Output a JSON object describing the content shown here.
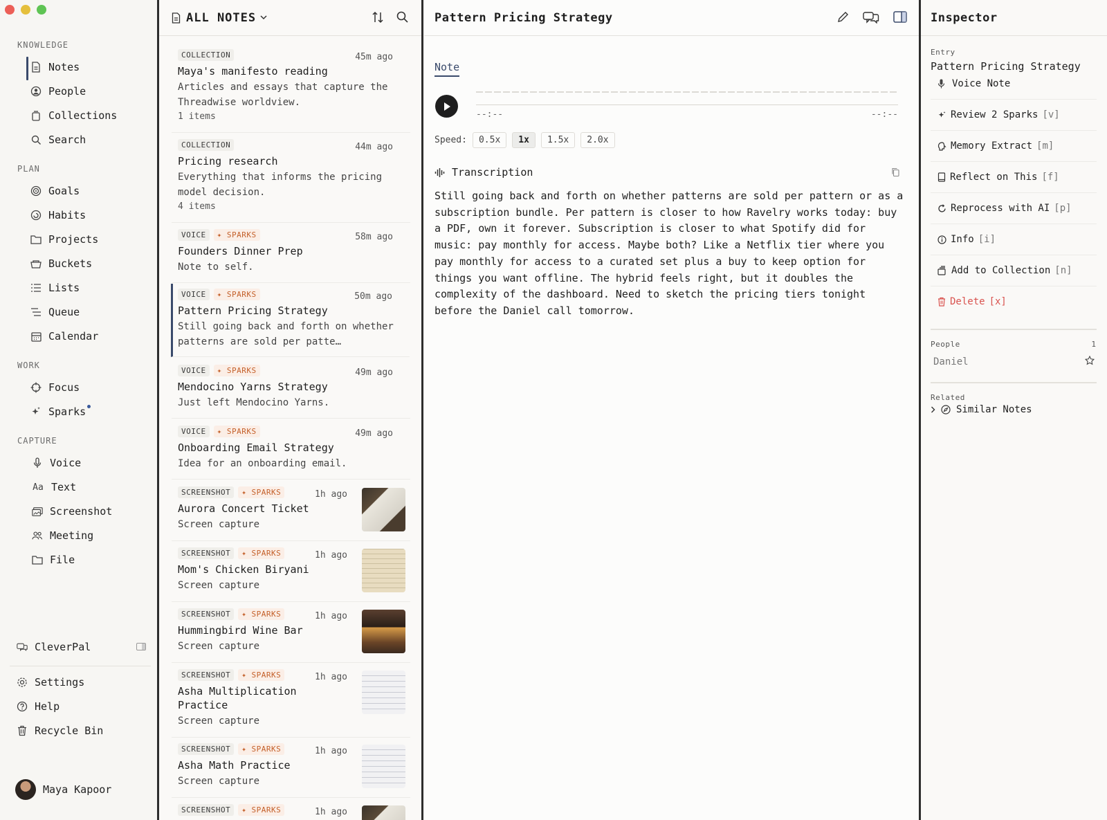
{
  "sidebar": {
    "sections": {
      "knowledge": "KNOWLEDGE",
      "plan": "PLAN",
      "work": "WORK",
      "capture": "CAPTURE"
    },
    "knowledge": [
      "Notes",
      "People",
      "Collections",
      "Search"
    ],
    "plan": [
      "Goals",
      "Habits",
      "Projects",
      "Buckets",
      "Lists",
      "Queue",
      "Calendar"
    ],
    "work": [
      "Focus",
      "Sparks"
    ],
    "capture": [
      {
        "icon_text": "",
        "label": "Voice"
      },
      {
        "icon_text": "Aa",
        "label": "Text"
      },
      {
        "icon_text": "",
        "label": "Screenshot"
      },
      {
        "icon_text": "",
        "label": "Meeting"
      },
      {
        "icon_text": "",
        "label": "File"
      }
    ],
    "cleverpal": "CleverPal",
    "bottom": [
      "Settings",
      "Help",
      "Recycle Bin"
    ],
    "user": "Maya Kapoor"
  },
  "list": {
    "title": "ALL NOTES",
    "notes": [
      {
        "type": "COLLECTION",
        "time": "45m ago",
        "title": "Maya's manifesto reading",
        "desc": "Articles and essays that capture the Threadwise worldview.",
        "count": "1 items"
      },
      {
        "type": "COLLECTION",
        "time": "44m ago",
        "title": "Pricing research",
        "desc": "Everything that informs the pricing model decision.",
        "count": "4 items"
      },
      {
        "type": "VOICE",
        "spark": "SPARKS",
        "time": "58m ago",
        "title": "Founders Dinner Prep",
        "desc": "Note to self."
      },
      {
        "type": "VOICE",
        "spark": "SPARKS",
        "time": "50m ago",
        "title": "Pattern Pricing Strategy",
        "desc": "Still going back and forth on whether patterns are sold per patte…"
      },
      {
        "type": "VOICE",
        "spark": "SPARKS",
        "time": "49m ago",
        "title": "Mendocino Yarns Strategy",
        "desc": "Just left Mendocino Yarns."
      },
      {
        "type": "VOICE",
        "spark": "SPARKS",
        "time": "49m ago",
        "title": "Onboarding Email Strategy",
        "desc": "Idea for an onboarding email."
      },
      {
        "type": "SCREENSHOT",
        "spark": "SPARKS",
        "time": "1h ago",
        "title": "Aurora Concert Ticket",
        "desc": "Screen capture"
      },
      {
        "type": "SCREENSHOT",
        "spark": "SPARKS",
        "time": "1h ago",
        "title": "Mom's Chicken Biryani",
        "desc": "Screen capture"
      },
      {
        "type": "SCREENSHOT",
        "spark": "SPARKS",
        "time": "1h ago",
        "title": "Hummingbird Wine Bar",
        "desc": "Screen capture"
      },
      {
        "type": "SCREENSHOT",
        "spark": "SPARKS",
        "time": "1h ago",
        "title": "Asha Multiplication Practice",
        "desc": "Screen capture"
      },
      {
        "type": "SCREENSHOT",
        "spark": "SPARKS",
        "time": "1h ago",
        "title": "Asha Math Practice",
        "desc": "Screen capture"
      },
      {
        "type": "SCREENSHOT",
        "spark": "SPARKS",
        "time": "1h ago"
      }
    ]
  },
  "main": {
    "title": "Pattern Pricing Strategy",
    "tab": "Note",
    "time_start": "--:--",
    "time_end": "--:--",
    "speed_label": "Speed:",
    "speeds": [
      "0.5x",
      "1x",
      "1.5x",
      "2.0x"
    ],
    "selected_speed": "1x",
    "transcription_label": "Transcription",
    "transcription": "Still going back and forth on whether patterns are sold per pattern or as a subscription bundle. Per pattern is closer to how Ravelry works today: buy a PDF, own it forever. Subscription is closer to what Spotify did for music: pay monthly for access. Maybe both? Like a Netflix tier where you pay monthly for access to a curated set plus a buy to keep option for things you want offline. The hybrid feels right, but it doubles the complexity of the dashboard. Need to sketch the pricing tiers tonight before the Daniel call tomorrow."
  },
  "inspector": {
    "title": "Inspector",
    "entry_label": "Entry",
    "entry_title": "Pattern Pricing Strategy",
    "entry_type": "Voice Note",
    "actions": [
      {
        "label": "Review 2 Sparks",
        "key": "[v]"
      },
      {
        "label": "Memory Extract",
        "key": "[m]"
      },
      {
        "label": "Reflect on This",
        "key": "[f]"
      },
      {
        "label": "Reprocess with AI",
        "key": "[p]"
      },
      {
        "label": "Info",
        "key": "[i]"
      },
      {
        "label": "Add to Collection",
        "key": "[n]"
      },
      {
        "label": "Delete",
        "key": "[x]"
      }
    ],
    "people_label": "People",
    "people_count": "1",
    "person": "Daniel",
    "related_label": "Related",
    "related_item": "Similar Notes"
  },
  "colors": {
    "accent": "#3a4a6b",
    "spark": "#c4602a",
    "danger": "#d9534f",
    "border": "#2d2d2d"
  }
}
